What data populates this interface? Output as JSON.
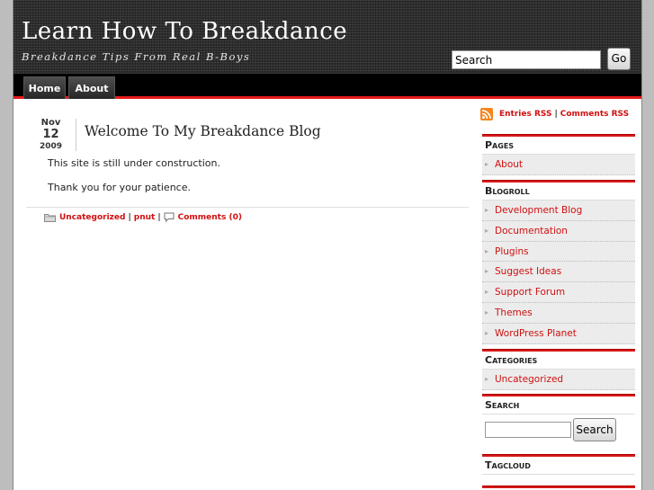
{
  "header": {
    "site_title": "Learn How To Breakdance",
    "site_description": "Breakdance Tips From Real B-Boys",
    "search_value": "Search",
    "go_label": "Go"
  },
  "nav": {
    "tabs": [
      {
        "label": "Home"
      },
      {
        "label": "About"
      }
    ]
  },
  "post": {
    "date": {
      "month": "Nov",
      "day": "12",
      "year": "2009"
    },
    "title": "Welcome To My Breakdance Blog",
    "paragraphs": [
      "This site is still under construction.",
      "Thank you for your patience."
    ],
    "meta": {
      "category": "Uncategorized",
      "author": "pnut",
      "comments": "Comments (0)",
      "separator": "|"
    }
  },
  "sidebar": {
    "rss": {
      "entries": "Entries RSS",
      "separator": "|",
      "comments": "Comments RSS"
    },
    "pages": {
      "title": "Pages",
      "items": [
        "About"
      ]
    },
    "blogroll": {
      "title": "Blogroll",
      "items": [
        "Development Blog",
        "Documentation",
        "Plugins",
        "Suggest Ideas",
        "Support Forum",
        "Themes",
        "WordPress Planet"
      ]
    },
    "categories": {
      "title": "Categories",
      "items": [
        "Uncategorized"
      ]
    },
    "search": {
      "title": "Search",
      "button_label": "Search"
    },
    "tagcloud": {
      "title": "Tagcloud"
    }
  },
  "colors": {
    "accent_red": "#d01010",
    "header_dark": "#2e2e2e",
    "nav_black": "#000000"
  },
  "icons": {
    "rss": "rss-feed-icon",
    "folder": "folder-icon",
    "comment": "comment-bubble-icon",
    "list_bullet": "chevron-right-icon"
  }
}
